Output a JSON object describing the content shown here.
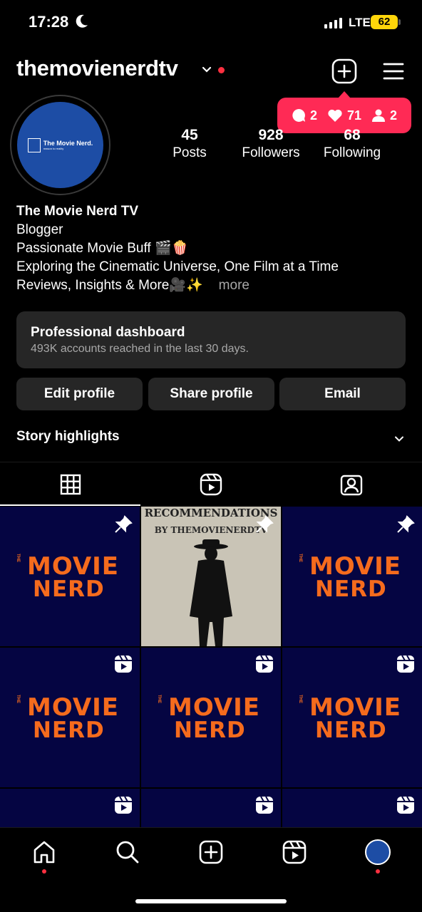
{
  "status": {
    "time": "17:28",
    "network": "LTE",
    "battery": "62"
  },
  "header": {
    "username": "themovienerdtv"
  },
  "activity": {
    "comments": "2",
    "likes": "71",
    "follows": "2"
  },
  "avatar": {
    "logo_text": "The Movie Nerd.",
    "logo_sub": "reason to reality"
  },
  "stats": [
    {
      "value": "45",
      "label": "Posts"
    },
    {
      "value": "928",
      "label": "Followers"
    },
    {
      "value": "68",
      "label": "Following"
    }
  ],
  "bio": {
    "name": "The Movie Nerd TV",
    "category": "Blogger",
    "line1": "Passionate Movie Buff 🎬🍿",
    "line2": "Exploring the Cinematic Universe, One Film at a Time",
    "line3": "Reviews, Insights & More🎥✨",
    "more": "more"
  },
  "dashboard": {
    "title": "Professional dashboard",
    "subtitle": "493K accounts reached in the last 30 days."
  },
  "buttons": {
    "edit": "Edit profile",
    "share": "Share profile",
    "email": "Email"
  },
  "highlights": {
    "label": "Story highlights"
  },
  "tile_logo": {
    "the": "THE",
    "line1": "MOVIE",
    "line2": "NERD"
  },
  "rec_tile": {
    "title": "RECOMMENDATIONS",
    "subtitle": "BY THEMOVIENERDTV"
  },
  "colors": {
    "accent_red": "#ff3040",
    "bubble": "#ff2a55",
    "tile_bg": "#050542",
    "logo_orange": "#f56b1d"
  }
}
